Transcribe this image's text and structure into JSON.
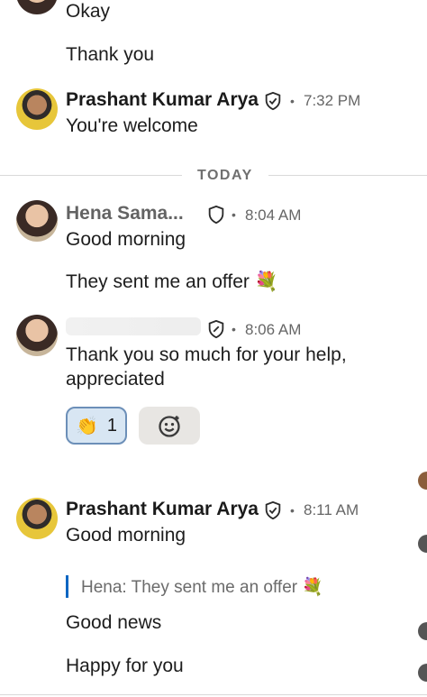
{
  "chat": {
    "messages_top": [
      {
        "text": "Okay"
      },
      {
        "text": "Thank you"
      }
    ],
    "block1": {
      "sender": "Prashant Kumar Arya",
      "time": "7:32 PM",
      "messages": [
        "You're welcome"
      ]
    },
    "divider_label": "TODAY",
    "block2": {
      "sender": "Hena Sama...",
      "time": "8:04 AM",
      "messages": [
        "Good morning",
        "They sent me an offer 💐"
      ]
    },
    "block3": {
      "time": "8:06 AM",
      "message": "Thank you so much for your help, appreciated",
      "reaction": {
        "emoji": "👏",
        "count": "1"
      }
    },
    "block4": {
      "sender": "Prashant Kumar Arya",
      "time": "8:11 AM",
      "messages": [
        "Good morning",
        "Good news",
        "Happy for you"
      ],
      "quote": "Hena: They sent me an offer 💐"
    }
  }
}
